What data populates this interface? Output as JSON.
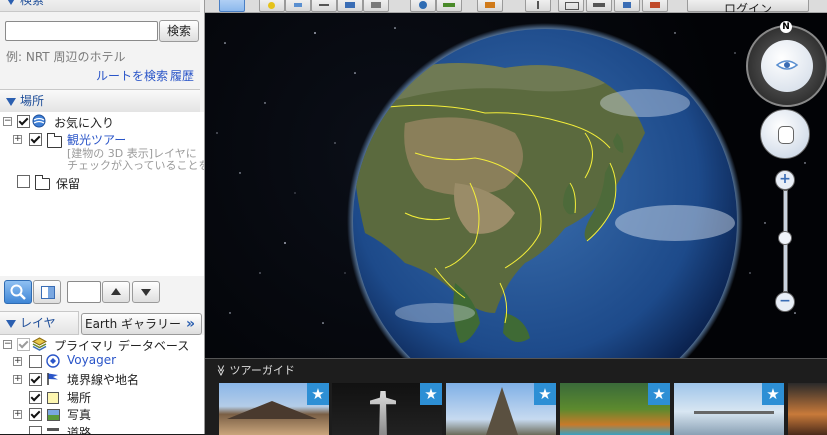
{
  "search": {
    "title": "検索",
    "button": "検索",
    "input_value": "",
    "example": "例: NRT 周辺のホテル",
    "route_link": "ルートを検索",
    "history_link": "履歴"
  },
  "places": {
    "title": "場所",
    "items": [
      {
        "label": "お気に入り",
        "checked": true
      },
      {
        "label": "観光ツアー",
        "checked": true
      },
      {
        "label": "保留",
        "checked": false
      }
    ],
    "tour_desc": [
      "[建物の 3D 表示]レイヤに",
      "チェックが入っていることを"
    ],
    "toolbar": {
      "search_icon": "magnifier-icon",
      "panel_icon": "panel-toggle-icon",
      "up_icon": "arrow-up-icon",
      "down_icon": "arrow-down-icon"
    }
  },
  "layers": {
    "title": "レイヤ",
    "gallery_button": "Earth ギャラリー",
    "gallery_arrow": "»",
    "items": [
      {
        "label": "プライマリ データベース",
        "checked": true
      },
      {
        "label": "Voyager",
        "checked": false
      },
      {
        "label": "境界線や地名",
        "checked": true
      },
      {
        "label": "場所",
        "checked": true
      },
      {
        "label": "写真",
        "checked": true
      },
      {
        "label": "道路",
        "checked": false
      }
    ]
  },
  "toolbar": {
    "login_label": "ログイン"
  },
  "navigation": {
    "north_label": "N"
  },
  "tour_guide": {
    "title": "ツアーガイド",
    "chevron": "≫",
    "star": "★"
  },
  "colors": {
    "accent": "#1f4e99",
    "link": "#2a55c8",
    "star_badge": "#2d8fd5",
    "borders_overlay": "#f4ee3a"
  }
}
